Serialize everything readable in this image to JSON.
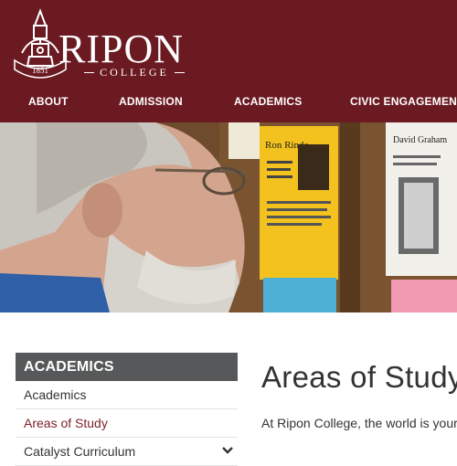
{
  "brand": {
    "name": "RIPON",
    "sub": "COLLEGE",
    "year": "1851"
  },
  "nav": [
    {
      "label": "ABOUT"
    },
    {
      "label": "ADMISSION"
    },
    {
      "label": "ACADEMICS"
    },
    {
      "label": "CIVIC ENGAGEMENT"
    }
  ],
  "hero": {
    "poster1_title": "Ron Rindo",
    "poster2_title": "David Graham"
  },
  "sidebar": {
    "heading": "ACADEMICS",
    "items": [
      {
        "label": "Academics"
      },
      {
        "label": "Areas of Study"
      },
      {
        "label": "Catalyst Curriculum"
      }
    ]
  },
  "main": {
    "title": "Areas of Study",
    "intro": "At Ripon College, the world is your"
  },
  "colors": {
    "brand_maroon": "#6b1a22",
    "sidebar_header": "#575859",
    "active_link": "#7a1f28"
  }
}
